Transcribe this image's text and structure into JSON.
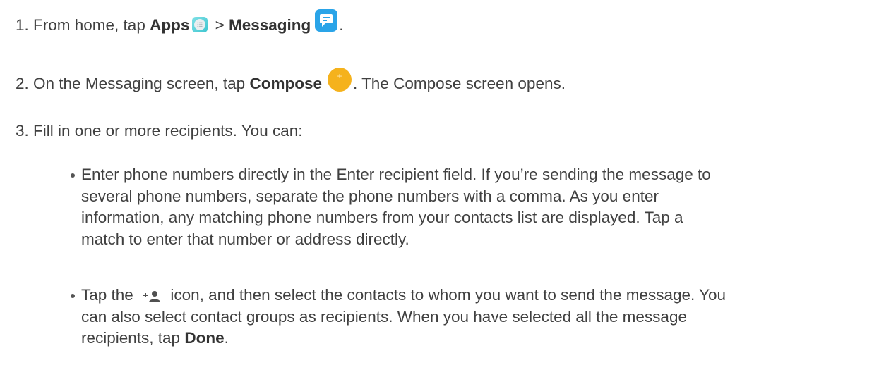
{
  "steps": [
    {
      "number": "1.",
      "text_a": "From home, tap ",
      "bold_a": "Apps",
      "text_b": " > ",
      "bold_b": "Messaging",
      "text_c": "."
    },
    {
      "number": "2.",
      "text_a": "On the Messaging screen, tap ",
      "bold_a": "Compose",
      "text_b": ". The Compose screen opens."
    },
    {
      "number": "3.",
      "text_a": "Fill in one or more recipients. You can:"
    }
  ],
  "bullets": [
    {
      "lines": [
        "Enter phone numbers directly in the Enter recipient field. If you’re sending the message to",
        "several phone numbers, separate the phone numbers with a comma. As you enter",
        "information, any matching phone numbers from your contacts list are displayed. Tap a",
        "match to enter that number or address directly."
      ]
    },
    {
      "line1_a": "Tap the ",
      "line1_b": " icon, and then select the contacts to whom you want to send the message. You",
      "line2": "can also select contact groups as recipients. When you have selected all the message",
      "line3_a": "recipients, tap ",
      "line3_bold": "Done",
      "line3_b": "."
    }
  ],
  "icons": {
    "apps": "apps-icon",
    "messaging": "messaging-icon",
    "compose": "compose-plus-icon",
    "compose_glyph": "+",
    "add_recipient": "add-person-icon"
  },
  "colors": {
    "text": "#404040",
    "apps_icon": "#3ec6d0",
    "messaging_icon": "#2aa4e8",
    "compose_icon": "#f5b21c"
  }
}
